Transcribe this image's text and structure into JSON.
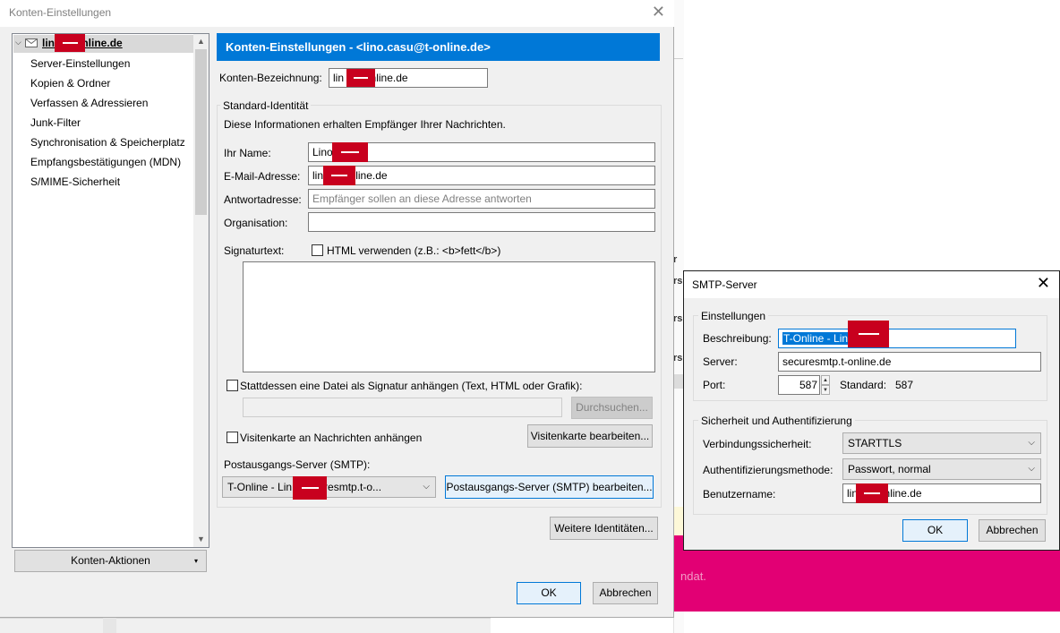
{
  "main": {
    "title": "Konten-Einstellungen",
    "header": "Konten-Einstellungen - <lino.casu@t-online.de>",
    "tree": {
      "account": "lin   @t-online.de",
      "items": [
        "Server-Einstellungen",
        "Kopien & Ordner",
        "Verfassen & Adressieren",
        "Junk-Filter",
        "Synchronisation & Speicherplatz",
        "Empfangsbestätigungen (MDN)",
        "S/MIME-Sicherheit"
      ]
    },
    "account_actions": "Konten-Aktionen",
    "konten_bezeichnung_label": "Konten-Bezeichnung:",
    "konten_bezeichnung_value": "lin      @t-online.de",
    "identity_group": "Standard-Identität",
    "identity_info": "Diese Informationen erhalten Empfänger Ihrer Nachrichten.",
    "name_label": "Ihr Name:",
    "name_value": "Lino",
    "email_label": "E-Mail-Adresse:",
    "email_value": "lin        @t-online.de",
    "reply_label": "Antwortadresse:",
    "reply_placeholder": "Empfänger sollen an diese Adresse antworten",
    "org_label": "Organisation:",
    "signature_label": "Signaturtext:",
    "html_checkbox": "HTML verwenden (z.B.: <b>fett</b>)",
    "attach_file_checkbox": "Stattdessen eine Datei als Signatur anhängen (Text, HTML oder Grafik):",
    "browse_button": "Durchsuchen...",
    "vcard_checkbox": "Visitenkarte an Nachrichten anhängen",
    "vcard_button": "Visitenkarte bearbeiten...",
    "smtp_label": "Postausgangs-Server (SMTP):",
    "smtp_combo": "T-Online - Lin          - securesmtp.t-o...",
    "smtp_edit_button": "Postausgangs-Server (SMTP) bearbeiten...",
    "more_identities_button": "Weitere Identitäten...",
    "ok": "OK",
    "cancel": "Abbrechen"
  },
  "smtp": {
    "title": "SMTP-Server",
    "settings_group": "Einstellungen",
    "desc_label": "Beschreibung:",
    "desc_value": "T-Online - Lin",
    "server_label": "Server:",
    "server_value": "securesmtp.t-online.de",
    "port_label": "Port:",
    "port_value": "587",
    "standard_label": "Standard:",
    "standard_value": "587",
    "security_group": "Sicherheit und Authentifizierung",
    "conn_sec_label": "Verbindungssicherheit:",
    "conn_sec_value": "STARTTLS",
    "auth_label": "Authentifizierungsmethode:",
    "auth_value": "Passwort, normal",
    "user_label": "Benutzername:",
    "user_value": "lin        @t-online.de",
    "ok": "OK",
    "cancel": "Abbrechen"
  },
  "background": {
    "pink_text": "ndat."
  },
  "colors": {
    "accent": "#0078d7",
    "redaction": "#c8001e",
    "brand_pink": "#e20074"
  }
}
